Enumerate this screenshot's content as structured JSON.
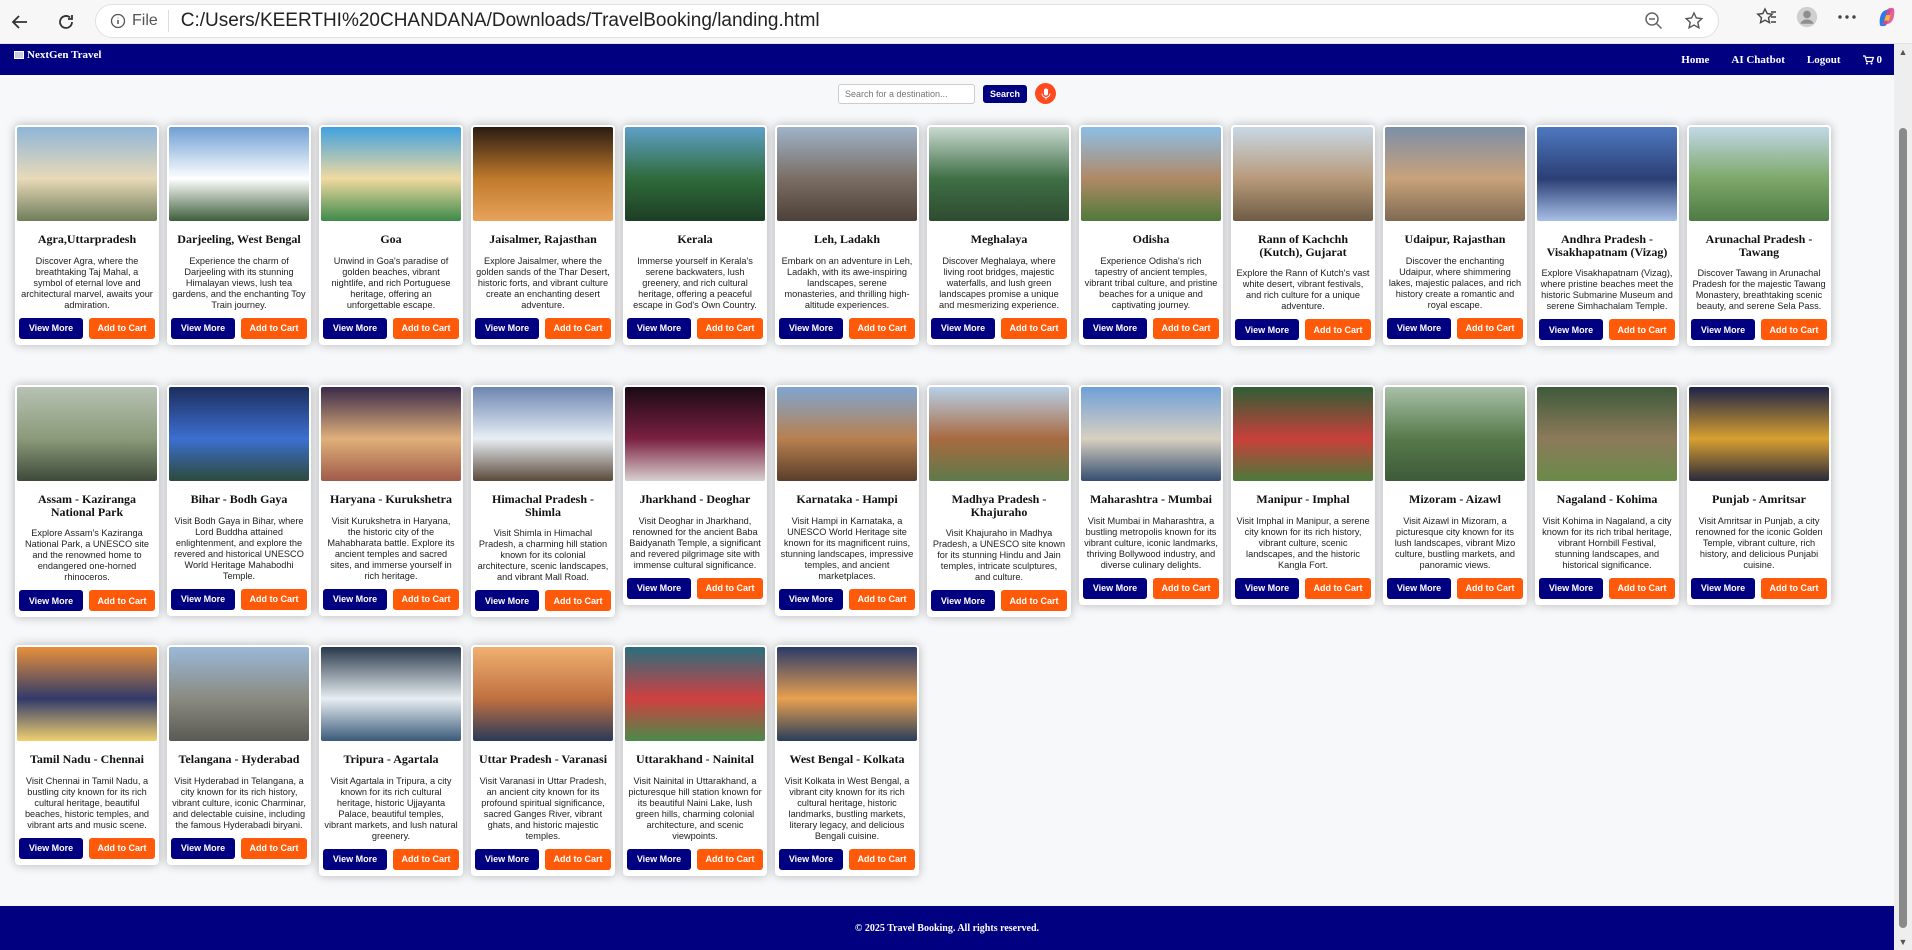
{
  "browser": {
    "protocol_label": "File",
    "url": "C:/Users/KEERTHI%20CHANDANA/Downloads/TravelBooking/landing.html"
  },
  "nav": {
    "brand": "NextGen Travel",
    "links": [
      "Home",
      "AI Chatbot",
      "Logout"
    ],
    "cart_count": "0"
  },
  "search": {
    "placeholder": "Search for a destination...",
    "button": "Search"
  },
  "buttons": {
    "view_more": "View More",
    "add_to_cart": "Add to Cart"
  },
  "cards": [
    {
      "title": "Agra,Uttarpradesh",
      "desc": "Discover Agra, where the breathtaking Taj Mahal, a symbol of eternal love and architectural marvel, awaits your admiration."
    },
    {
      "title": "Darjeeling, West Bengal",
      "desc": "Experience the charm of Darjeeling with its stunning Himalayan views, lush tea gardens, and the enchanting Toy Train journey."
    },
    {
      "title": "Goa",
      "desc": "Unwind in Goa's paradise of golden beaches, vibrant nightlife, and rich Portuguese heritage, offering an unforgettable escape."
    },
    {
      "title": "Jaisalmer, Rajasthan",
      "desc": "Explore Jaisalmer, where the golden sands of the Thar Desert, historic forts, and vibrant culture create an enchanting desert adventure."
    },
    {
      "title": "Kerala",
      "desc": "Immerse yourself in Kerala's serene backwaters, lush greenery, and rich cultural heritage, offering a peaceful escape in God's Own Country."
    },
    {
      "title": "Leh, Ladakh",
      "desc": "Embark on an adventure in Leh, Ladakh, with its awe-inspiring landscapes, serene monasteries, and thrilling high-altitude experiences."
    },
    {
      "title": "Meghalaya",
      "desc": "Discover Meghalaya, where living root bridges, majestic waterfalls, and lush green landscapes promise a unique and mesmerizing experience."
    },
    {
      "title": "Odisha",
      "desc": "Experience Odisha's rich tapestry of ancient temples, vibrant tribal culture, and pristine beaches for a unique and captivating journey."
    },
    {
      "title": "Rann of Kachchh (Kutch), Gujarat",
      "desc": "Explore the Rann of Kutch's vast white desert, vibrant festivals, and rich culture for a unique adventure."
    },
    {
      "title": "Udaipur, Rajasthan",
      "desc": "Discover the enchanting Udaipur, where shimmering lakes, majestic palaces, and rich history create a romantic and royal escape."
    },
    {
      "title": "Andhra Pradesh - Visakhapatnam (Vizag)",
      "desc": "Explore Visakhapatnam (Vizag), where pristine beaches meet the historic Submarine Museum and serene Simhachalam Temple."
    },
    {
      "title": "Arunachal Pradesh - Tawang",
      "desc": "Discover Tawang in Arunachal Pradesh for the majestic Tawang Monastery, breathtaking scenic beauty, and serene Sela Pass."
    },
    {
      "title": "Assam - Kaziranga National Park",
      "desc": "Explore Assam's Kaziranga National Park, a UNESCO site and the renowned home to endangered one-horned rhinoceros."
    },
    {
      "title": "Bihar - Bodh Gaya",
      "desc": "Visit Bodh Gaya in Bihar, where Lord Buddha attained enlightenment, and explore the revered and historical UNESCO World Heritage Mahabodhi Temple."
    },
    {
      "title": "Haryana - Kurukshetra",
      "desc": "Visit Kurukshetra in Haryana, the historic city of the Mahabharata battle. Explore its ancient temples and sacred sites, and immerse yourself in rich heritage."
    },
    {
      "title": "Himachal Pradesh - Shimla",
      "desc": "Visit Shimla in Himachal Pradesh, a charming hill station known for its colonial architecture, scenic landscapes, and vibrant Mall Road."
    },
    {
      "title": "Jharkhand - Deoghar",
      "desc": "Visit Deoghar in Jharkhand, renowned for the ancient Baba Baidyanath Temple, a significant and revered pilgrimage site with immense cultural significance."
    },
    {
      "title": "Karnataka - Hampi",
      "desc": "Visit Hampi in Karnataka, a UNESCO World Heritage site known for its magnificent ruins, stunning landscapes, impressive temples, and ancient marketplaces."
    },
    {
      "title": "Madhya Pradesh - Khajuraho",
      "desc": "Visit Khajuraho in Madhya Pradesh, a UNESCO site known for its stunning Hindu and Jain temples, intricate sculptures, and culture."
    },
    {
      "title": "Maharashtra - Mumbai",
      "desc": "Visit Mumbai in Maharashtra, a bustling metropolis known for its vibrant culture, iconic landmarks, thriving Bollywood industry, and diverse culinary delights."
    },
    {
      "title": "Manipur - Imphal",
      "desc": "Visit Imphal in Manipur, a serene city known for its rich history, vibrant culture, scenic landscapes, and the historic Kangla Fort."
    },
    {
      "title": "Mizoram - Aizawl",
      "desc": "Visit Aizawl in Mizoram, a picturesque city known for its lush landscapes, vibrant Mizo culture, bustling markets, and panoramic views."
    },
    {
      "title": "Nagaland - Kohima",
      "desc": "Visit Kohima in Nagaland, a city known for its rich tribal heritage, vibrant Hornbill Festival, stunning landscapes, and historical significance."
    },
    {
      "title": "Punjab - Amritsar",
      "desc": "Visit Amritsar in Punjab, a city renowned for the iconic Golden Temple, vibrant culture, rich history, and delicious Punjabi cuisine."
    },
    {
      "title": "Tamil Nadu - Chennai",
      "desc": "Visit Chennai in Tamil Nadu, a bustling city known for its rich cultural heritage, beautiful beaches, historic temples, and vibrant arts and music scene."
    },
    {
      "title": "Telangana - Hyderabad",
      "desc": "Visit Hyderabad in Telangana, a city known for its rich history, vibrant culture, iconic Charminar, and delectable cuisine, including the famous Hyderabadi biryani."
    },
    {
      "title": "Tripura - Agartala",
      "desc": "Visit Agartala in Tripura, a city known for its rich cultural heritage, historic Ujjayanta Palace, beautiful temples, vibrant markets, and lush natural greenery."
    },
    {
      "title": "Uttar Pradesh - Varanasi",
      "desc": "Visit Varanasi in Uttar Pradesh, an ancient city known for its profound spiritual significance, sacred Ganges River, vibrant ghats, and historic majestic temples."
    },
    {
      "title": "Uttarakhand - Nainital",
      "desc": "Visit Nainital in Uttarakhand, a picturesque hill station known for its beautiful Naini Lake, lush green hills, charming colonial architecture, and scenic viewpoints."
    },
    {
      "title": "West Bengal - Kolkata",
      "desc": "Visit Kolkata in West Bengal, a vibrant city known for its rich cultural heritage, historic landmarks, bustling markets, literary legacy, and delicious Bengali cuisine."
    }
  ],
  "footer": "© 2025 Travel Booking. All rights reserved.",
  "colors": {
    "navy": "#000080",
    "orange": "#ff5a0a"
  }
}
